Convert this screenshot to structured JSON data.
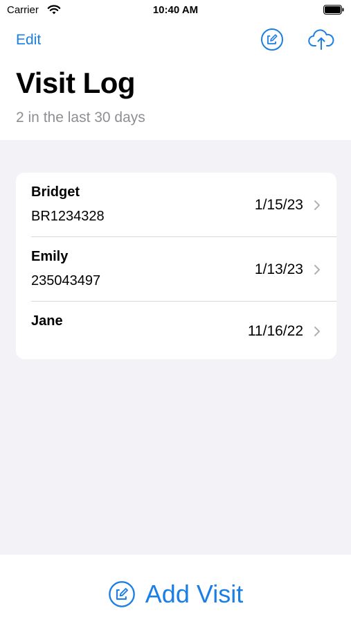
{
  "status_bar": {
    "carrier": "Carrier",
    "time": "10:40 AM",
    "wifi_icon": "wifi-icon",
    "battery_icon": "battery-icon"
  },
  "nav": {
    "edit_label": "Edit",
    "compose_icon": "compose-icon",
    "upload_icon": "cloud-upload-icon"
  },
  "header": {
    "title": "Visit Log",
    "subtitle": "2 in the last 30 days"
  },
  "visits": [
    {
      "name": "Bridget",
      "id": "BR1234328",
      "date": "1/15/23"
    },
    {
      "name": "Emily",
      "id": "235043497",
      "date": "1/13/23"
    },
    {
      "name": "Jane",
      "id": "",
      "date": "11/16/22"
    }
  ],
  "footer": {
    "add_visit_label": "Add Visit",
    "add_icon": "compose-icon"
  },
  "colors": {
    "accent": "#1a7ee6",
    "background": "#f2f2f7",
    "secondary_text": "#8e8e93"
  }
}
